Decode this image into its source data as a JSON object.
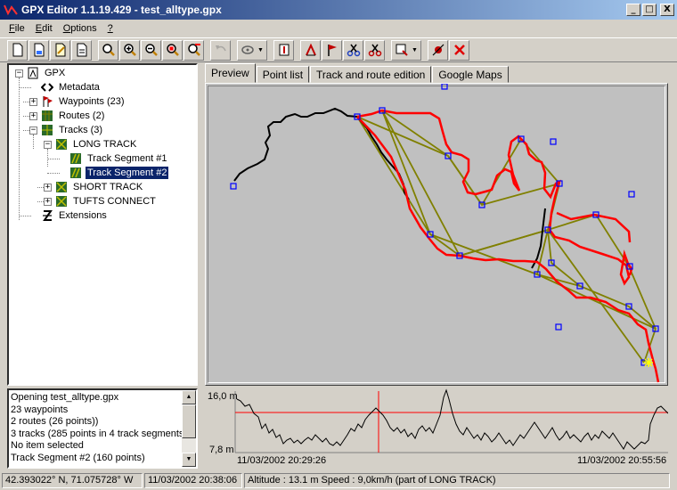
{
  "window": {
    "title": "GPX Editor 1.1.19.429 - test_alltype.gpx",
    "minimize": "_",
    "maximize": "□",
    "close": "X"
  },
  "menu": [
    {
      "label": "File",
      "key": "F",
      "rest": "ile"
    },
    {
      "label": "Edit",
      "key": "E",
      "rest": "dit"
    },
    {
      "label": "Options",
      "key": "O",
      "rest": "ptions"
    },
    {
      "label": "?",
      "key": "?",
      "rest": ""
    }
  ],
  "toolbar": {
    "buttons": [
      "new-file",
      "open-file",
      "edit-file",
      "save-file",
      "zoom-fit",
      "zoom-in",
      "zoom-out",
      "zoom-select",
      "zoom-tool",
      "undo",
      "rotate",
      "settings",
      "edit-track",
      "add-waypoint",
      "cut-track",
      "split-track",
      "tool-menu",
      "remove-point",
      "delete"
    ]
  },
  "tree": {
    "root": "GPX",
    "metadata": "Metadata",
    "waypoints": "Waypoints (23)",
    "routes": "Routes (2)",
    "tracks": "Tracks (3)",
    "long_track": "LONG TRACK",
    "seg1": "Track Segment #1",
    "seg2": "Track Segment #2",
    "short_track": "SHORT TRACK",
    "tufts": "TUFTS CONNECT",
    "extensions": "Extensions"
  },
  "log": {
    "lines": [
      "Opening test_alltype.gpx",
      "23 waypoints",
      "2 routes (26 points))",
      "3 tracks (285 points in 4 track segments)",
      "No item selected",
      "Track Segment #2 (160 points)"
    ]
  },
  "tabs": [
    "Preview",
    "Point list",
    "Track and route edition",
    "Google Maps"
  ],
  "profile": {
    "ymax_label": "16,0 m",
    "ymin_label": "7,8 m",
    "xstart_label": "11/03/2002 20:29:26",
    "xend_label": "11/03/2002 20:55:56"
  },
  "status": {
    "coords": "42.393022° N, 71.075728° W",
    "time": "11/03/2002 20:38:06",
    "info": "Altitude : 13.1 m Speed : 9,0km/h (part of LONG TRACK)"
  },
  "colors": {
    "track_selected": "#ff0000",
    "track_black": "#000000",
    "route": "#808000",
    "waypoint": "#0000ff"
  }
}
